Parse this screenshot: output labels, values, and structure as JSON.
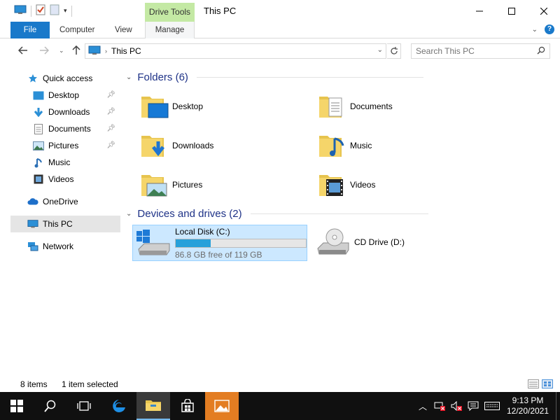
{
  "window": {
    "title": "This PC",
    "contextual_tab_group": "Drive Tools"
  },
  "ribbon": {
    "tabs": [
      {
        "label": "File"
      },
      {
        "label": "Computer"
      },
      {
        "label": "View"
      },
      {
        "label": "Manage"
      }
    ]
  },
  "address": {
    "crumb": "This PC",
    "search_placeholder": "Search This PC"
  },
  "sidebar": {
    "items": [
      {
        "label": "Quick access",
        "icon": "star-icon"
      },
      {
        "label": "Desktop",
        "icon": "desktop-icon",
        "pinned": true
      },
      {
        "label": "Downloads",
        "icon": "download-arrow-icon",
        "pinned": true
      },
      {
        "label": "Documents",
        "icon": "document-icon",
        "pinned": true
      },
      {
        "label": "Pictures",
        "icon": "pictures-icon",
        "pinned": true
      },
      {
        "label": "Music",
        "icon": "music-note-icon"
      },
      {
        "label": "Videos",
        "icon": "video-icon"
      },
      {
        "label": "OneDrive",
        "icon": "cloud-icon"
      },
      {
        "label": "This PC",
        "icon": "computer-icon",
        "selected": true
      },
      {
        "label": "Network",
        "icon": "network-icon"
      }
    ]
  },
  "content": {
    "folders_header": "Folders (6)",
    "folders": [
      {
        "label": "Desktop"
      },
      {
        "label": "Documents"
      },
      {
        "label": "Downloads"
      },
      {
        "label": "Music"
      },
      {
        "label": "Pictures"
      },
      {
        "label": "Videos"
      }
    ],
    "drives_header": "Devices and drives (2)",
    "drives": [
      {
        "name": "Local Disk (C:)",
        "free_text": "86.8 GB free of 119 GB",
        "used_fraction": 0.27,
        "selected": true
      },
      {
        "name": "CD Drive (D:)"
      }
    ]
  },
  "status": {
    "item_count": "8 items",
    "selection": "1 item selected"
  },
  "taskbar": {
    "clock_time": "9:13 PM",
    "clock_date": "12/20/2021"
  },
  "colors": {
    "accent": "#1979ca",
    "contextual_tab": "#c4e9a4",
    "progress": "#26a0da",
    "selection": "#cce8ff",
    "taskbar": "#101010",
    "header_text": "#1e3287"
  }
}
